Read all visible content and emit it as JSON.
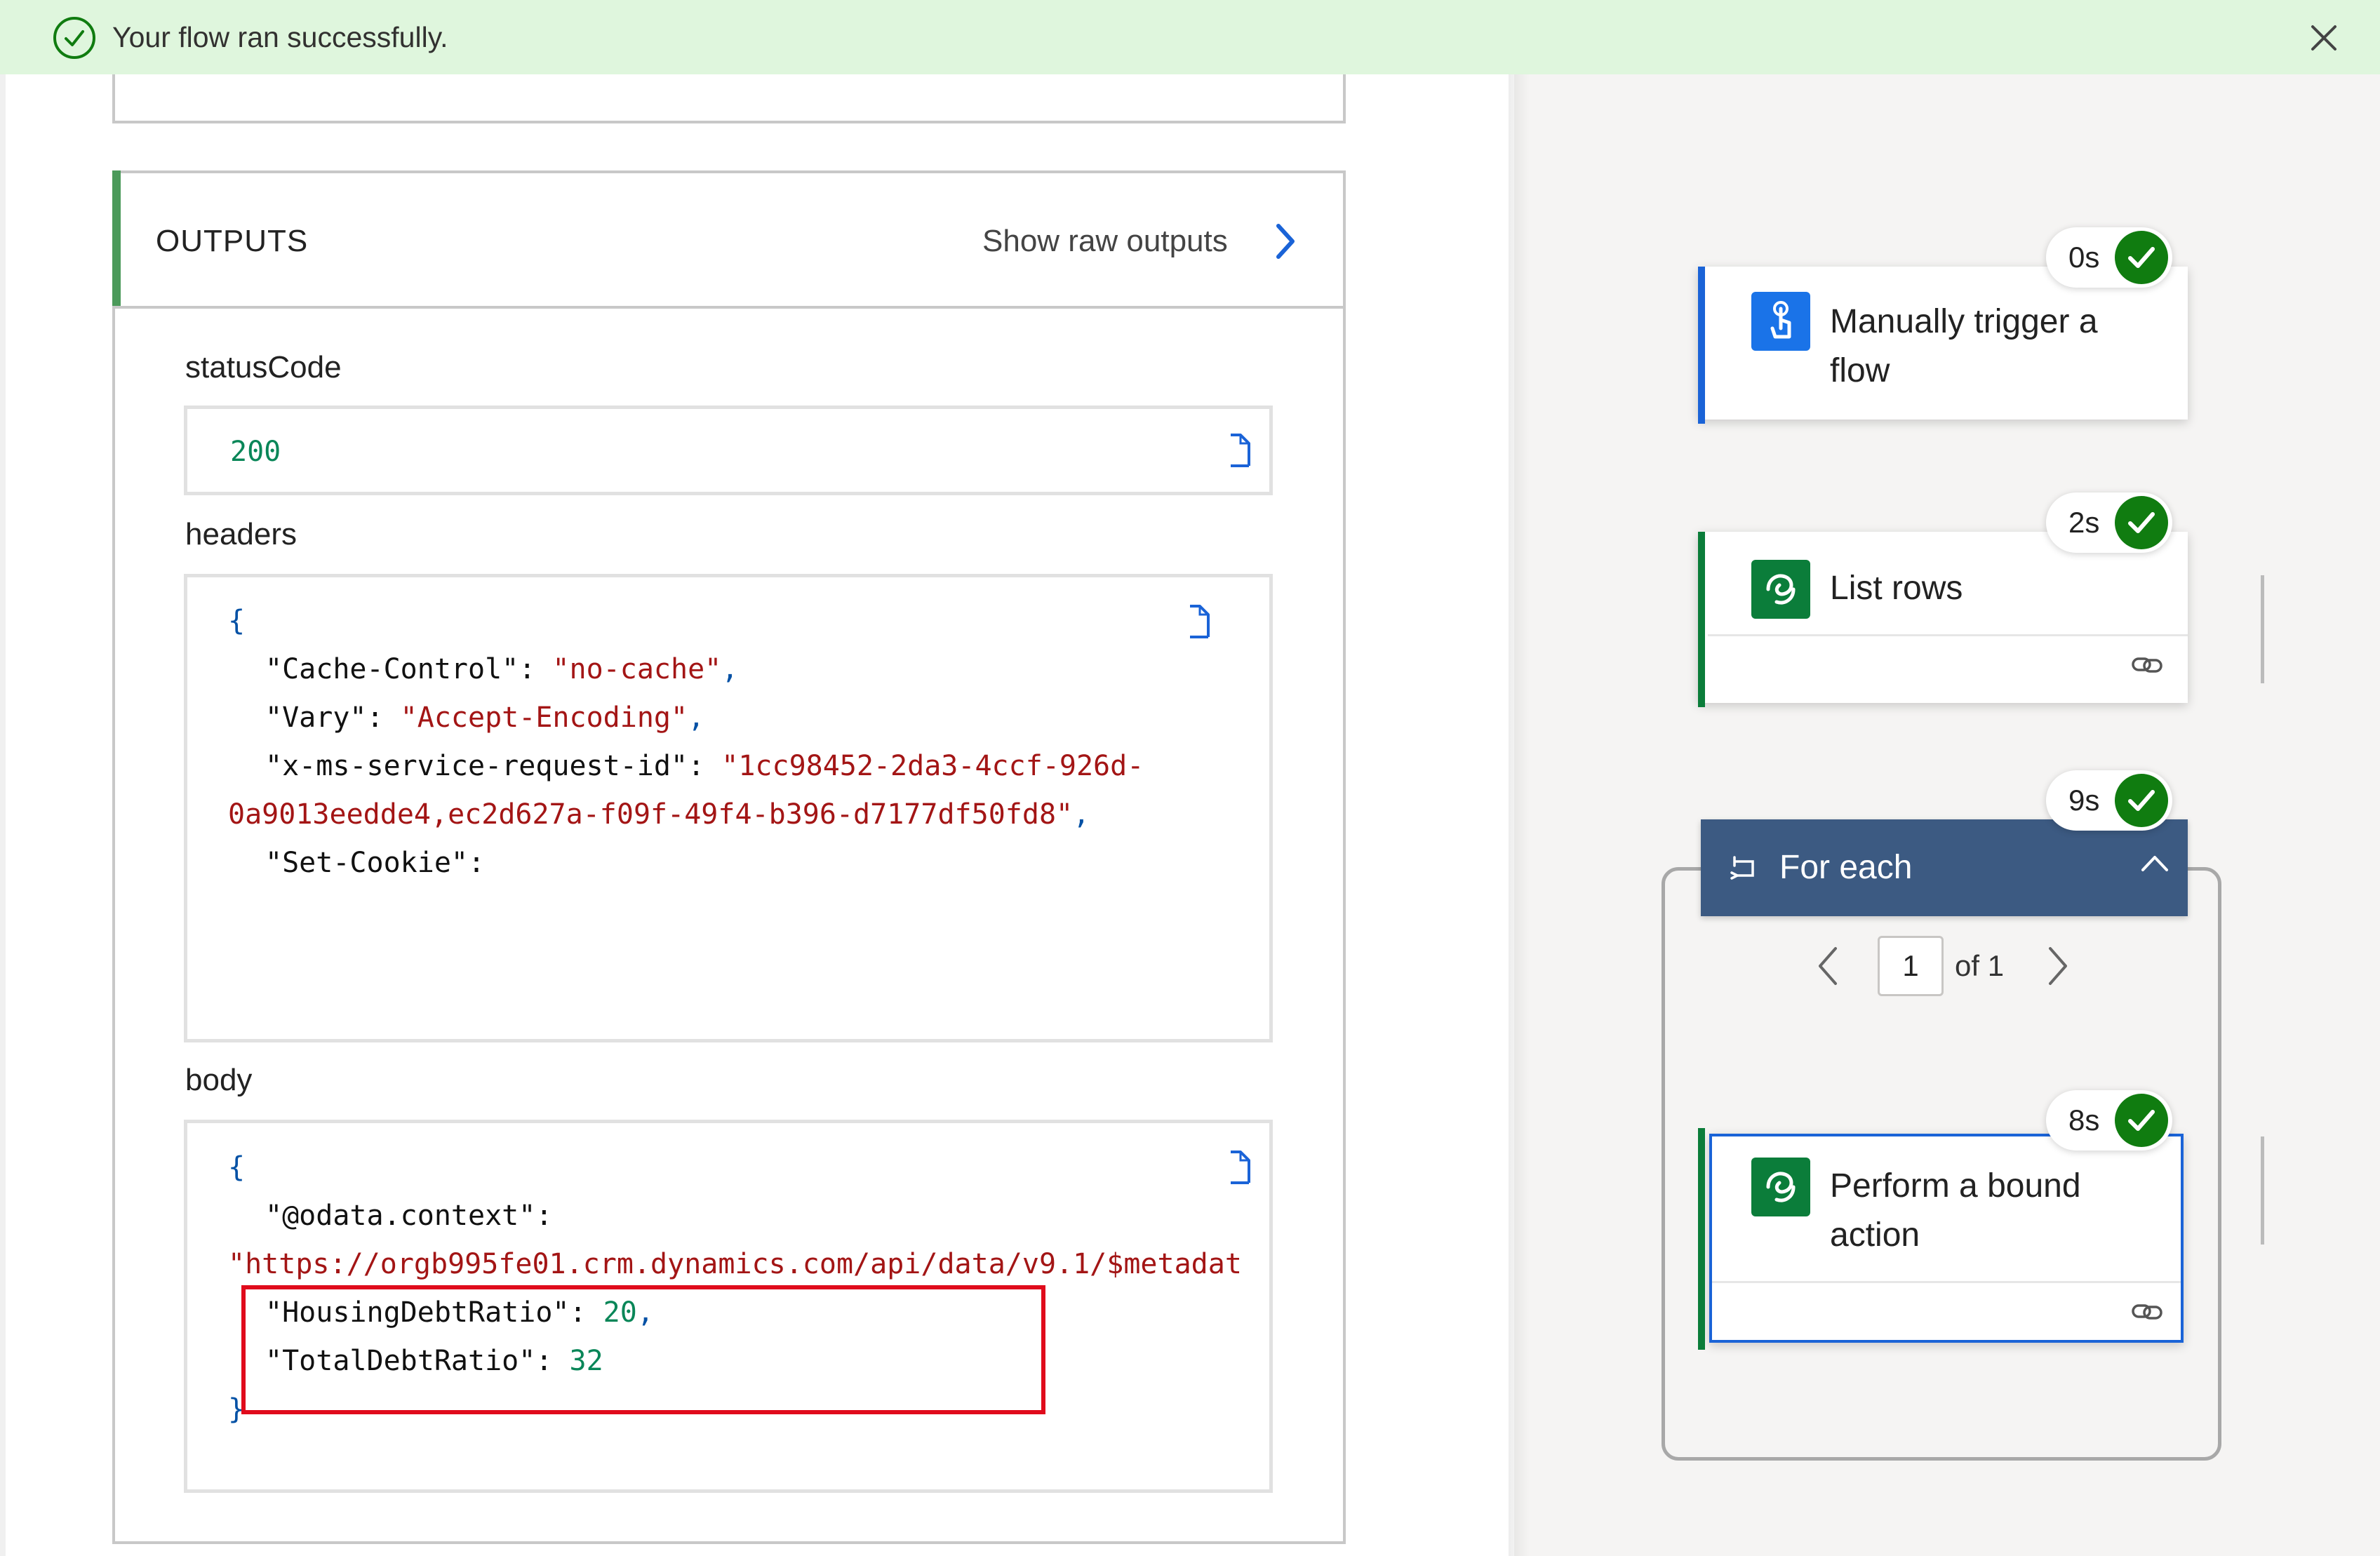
{
  "banner": {
    "message": "Your flow ran successfully.",
    "icon": "check-circle-icon",
    "close_icon": "close-icon",
    "background": "#dff6dd",
    "accent": "#107c10"
  },
  "outputs": {
    "title": "OUTPUTS",
    "raw_link": "Show raw outputs",
    "status_label": "statusCode",
    "status_value": "200",
    "headers_label": "headers",
    "headers_lines": {
      "open": "{",
      "cache_key": "\"Cache-Control\"",
      "cache_val": "\"no-cache\"",
      "vary_key": "\"Vary\"",
      "vary_val": "\"Accept-Encoding\"",
      "reqid_key": "\"x-ms-service-request-id\"",
      "reqid_val_1": "\"1cc98452-2da3-4ccf-926d-",
      "reqid_val_2": "0a9013eedde4,ec2d627a-f09f-49f4-b396-d7177df50fd8\"",
      "cookie_key": "\"Set-Cookie\""
    },
    "body_label": "body",
    "body_lines": {
      "open": "{",
      "context_key": "\"@odata.context\"",
      "context_val": "\"https://orgb995fe01.crm.dynamics.com/api/data/v9.1/$metadat",
      "housing_key": "\"HousingDebtRatio\"",
      "housing_val": "20",
      "total_key": "\"TotalDebtRatio\"",
      "total_val": "32",
      "close": "}"
    },
    "highlight_color": "#e00b1c"
  },
  "flow": {
    "trigger": {
      "title": "Manually trigger a flow",
      "duration": "0s",
      "status": "succeeded",
      "icon": "touch-trigger-icon",
      "accent": "#1a63d7"
    },
    "list_rows": {
      "title": "List rows",
      "duration": "2s",
      "status": "succeeded",
      "icon": "dataverse-icon",
      "accent": "#0b7d3a"
    },
    "for_each": {
      "title": "For each",
      "duration": "9s",
      "status": "succeeded",
      "icon": "loop-icon",
      "header_color": "#3c5a82",
      "page_current": "1",
      "page_of": "of 1"
    },
    "perform_action": {
      "title": "Perform a bound action",
      "duration": "8s",
      "status": "succeeded",
      "icon": "dataverse-icon",
      "accent": "#0b7d3a"
    }
  }
}
